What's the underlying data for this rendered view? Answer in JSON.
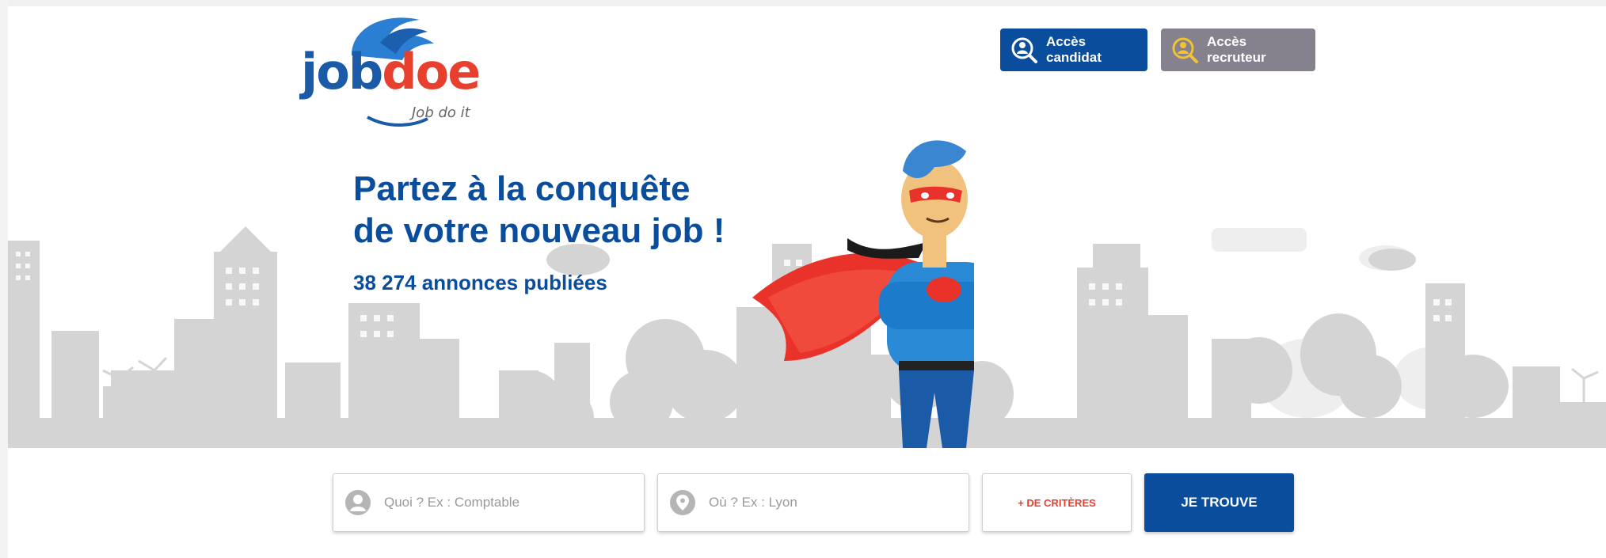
{
  "brand": {
    "logo_part1": "job",
    "logo_part2": "doe",
    "tagline": "Job do it",
    "primary_color": "#0a4d9c",
    "accent_color": "#e8402f"
  },
  "header": {
    "candidate_button": "Accès candidat",
    "recruiter_button": "Accès recruteur",
    "candidate_icon": "user-search-icon",
    "recruiter_icon": "user-search-icon"
  },
  "hero": {
    "headline_line1": "Partez à la conquête",
    "headline_line2": "de votre nouveau job !",
    "listing_count": "38 274 annonces publiées"
  },
  "search": {
    "what_placeholder": "Quoi ? Ex : Comptable",
    "where_placeholder": "Où ? Ex : Lyon",
    "what_icon": "user-icon",
    "where_icon": "location-pin-icon",
    "criteria_button": "+ DE CRITÈRES",
    "submit_button": "JE TROUVE"
  }
}
